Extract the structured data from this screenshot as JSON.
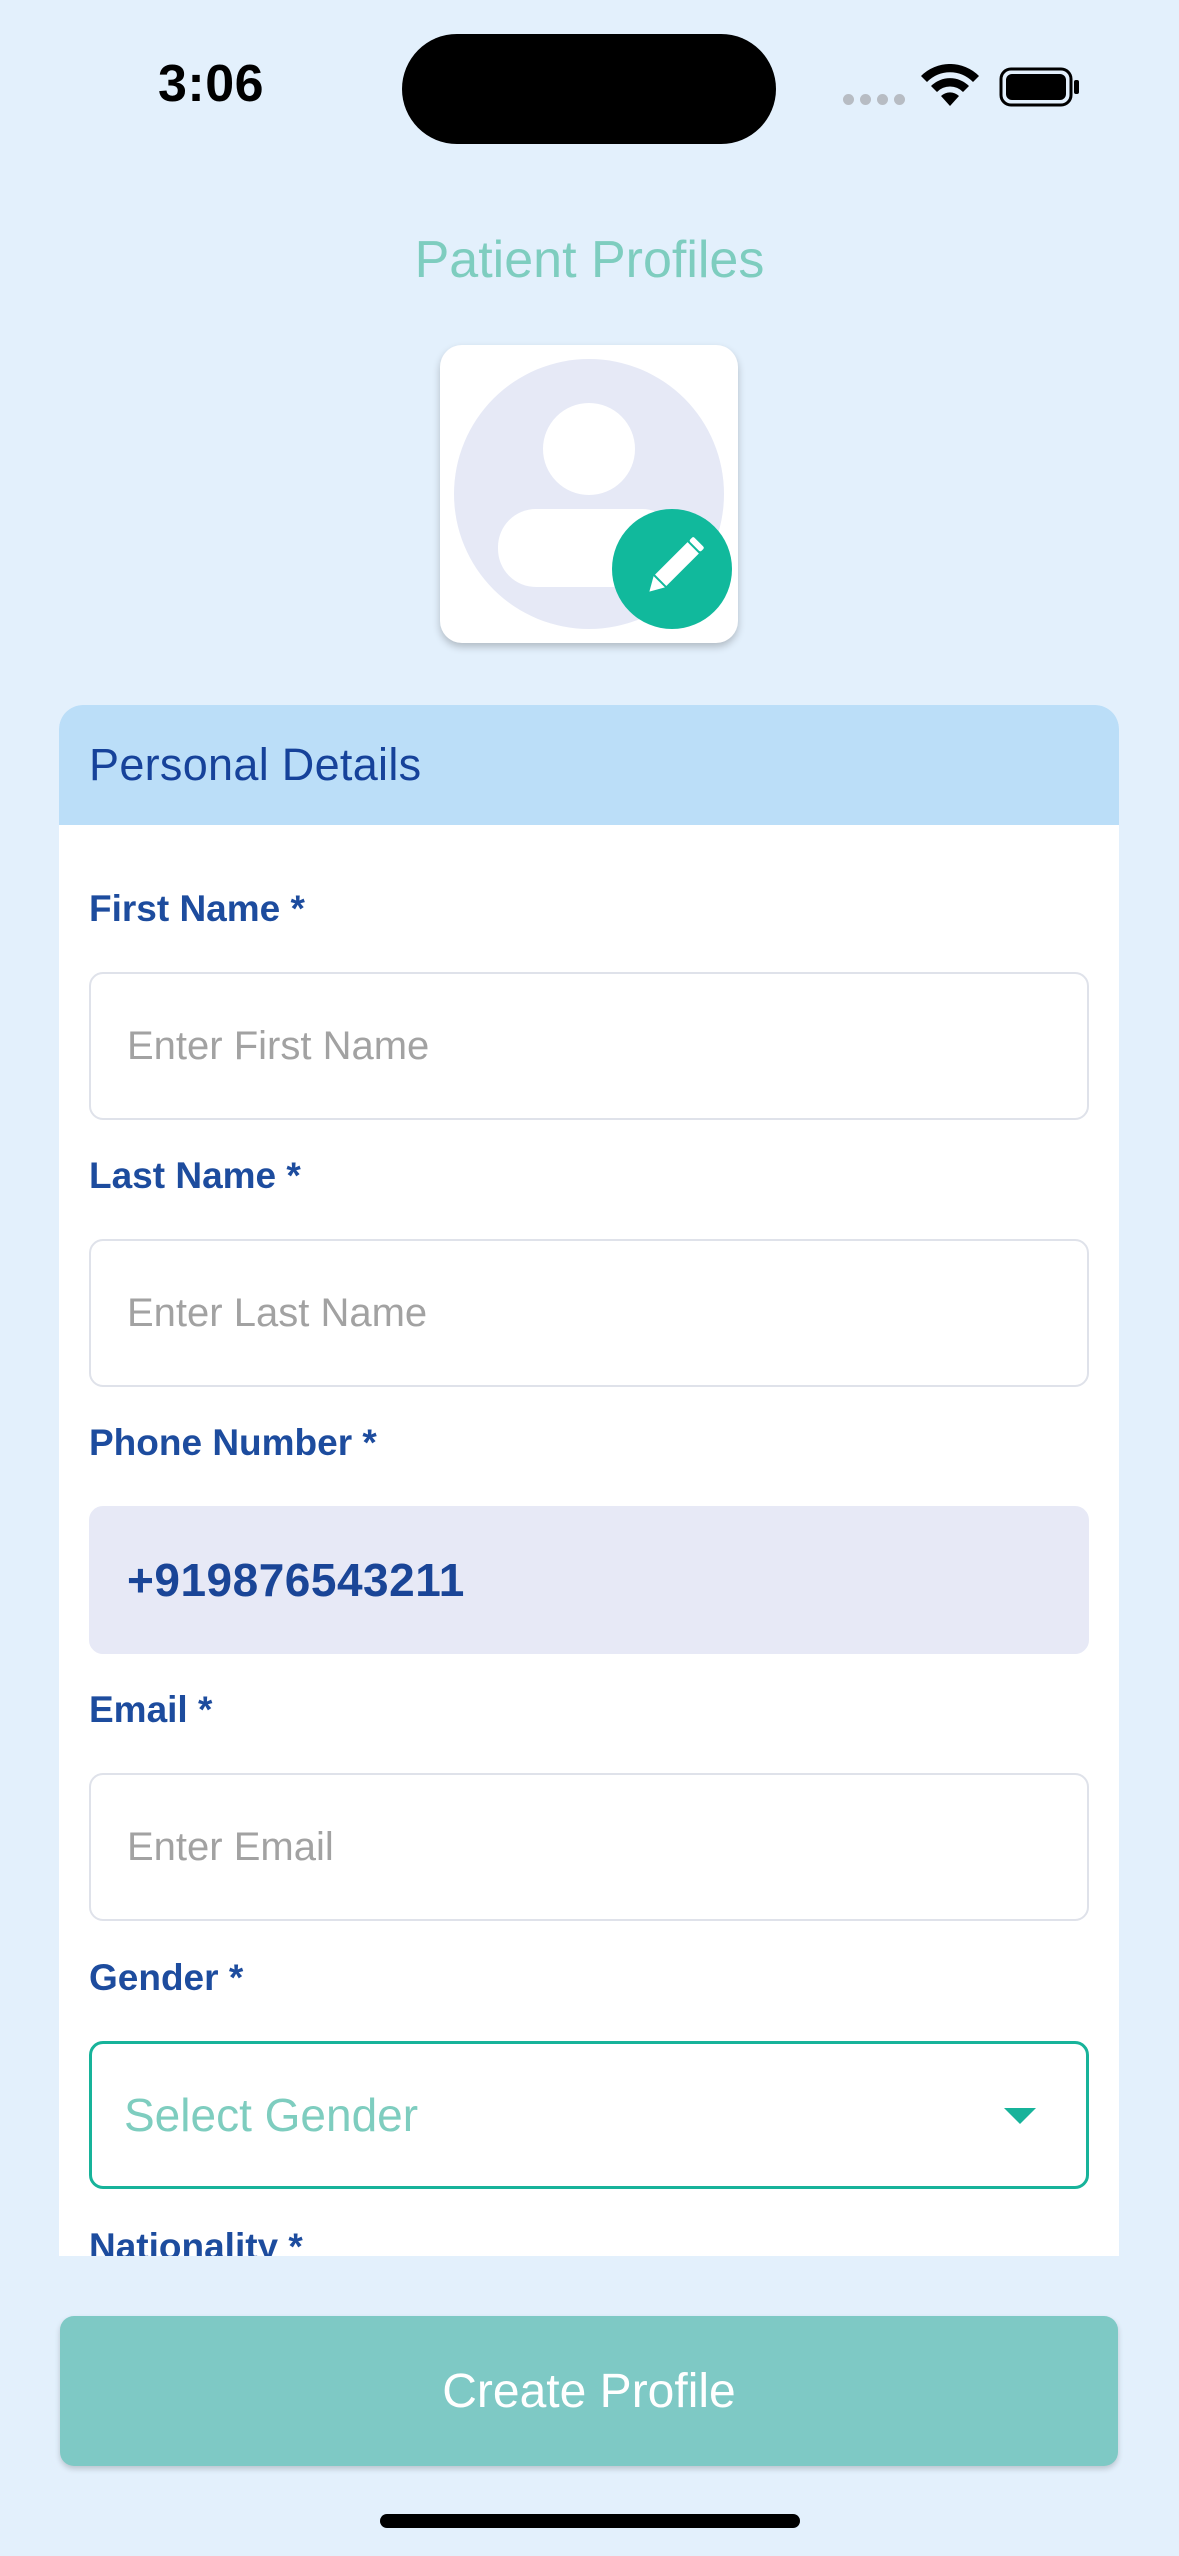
{
  "status_bar": {
    "time": "3:06"
  },
  "header": {
    "title": "Patient Profiles"
  },
  "avatar": {
    "placeholder_icon": "person-placeholder-icon",
    "edit_icon": "pencil-icon",
    "edit_badge_color": "#11b99c"
  },
  "personal_details": {
    "title": "Personal Details",
    "first_name": {
      "label": "First Name *",
      "placeholder": "Enter First Name",
      "value": ""
    },
    "last_name": {
      "label": "Last Name *",
      "placeholder": "Enter Last Name",
      "value": ""
    },
    "phone": {
      "label": "Phone Number *",
      "value": "+919876543211"
    },
    "email": {
      "label": "Email *",
      "placeholder": "Enter Email",
      "value": ""
    },
    "gender": {
      "label": "Gender *",
      "selected": "Select Gender"
    },
    "nationality": {
      "label": "Nationality *"
    }
  },
  "footer": {
    "create_button_label": "Create Profile"
  },
  "colors": {
    "background": "#e3f0fc",
    "accent_teal": "#17b39a",
    "label_blue": "#1d4c9e",
    "title_teal": "#7ecdbf",
    "button": "#7ec9c5"
  }
}
